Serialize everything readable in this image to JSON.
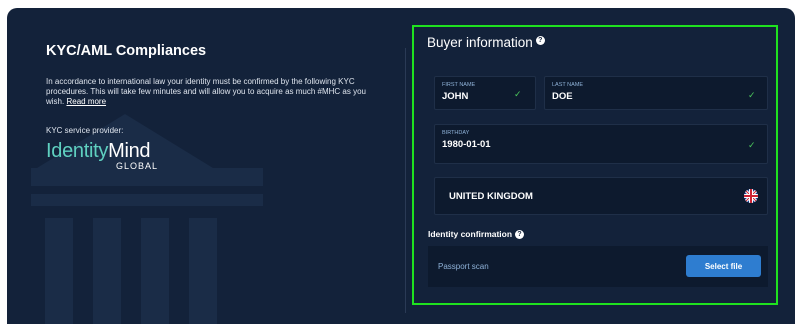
{
  "kyc": {
    "title": "KYC/AML Compliances",
    "description": "In accordance to international law your identity must be confirmed by the following KYC procedures. This will take few minutes and will allow you to acquire as much #MHC as you wish.",
    "read_more": "Read more",
    "provider_label": "KYC service provider:",
    "logo_part1": "Identity",
    "logo_part2": "Mind",
    "logo_sub": "GLOBAL"
  },
  "buyer": {
    "title": "Buyer information",
    "first_name_label": "FIRST NAME",
    "first_name": "JOHN",
    "last_name_label": "LAST NAME",
    "last_name": "DOE",
    "birthday_label": "BIRTHDAY",
    "birthday": "1980-01-01",
    "country": "UNITED KINGDOM",
    "identity_title": "Identity confirmation",
    "passport_label": "Passport scan",
    "select_file": "Select file"
  },
  "colors": {
    "panel_bg": "#13223a",
    "field_bg": "#0d1a2e",
    "highlight_border": "#1fe21f",
    "accent_button": "#2e7dd0",
    "check": "#4cc95c"
  },
  "icons": {
    "help": "question-circle-icon",
    "check": "check-icon",
    "flag": "uk-flag-icon",
    "background": "bank-building-icon"
  }
}
